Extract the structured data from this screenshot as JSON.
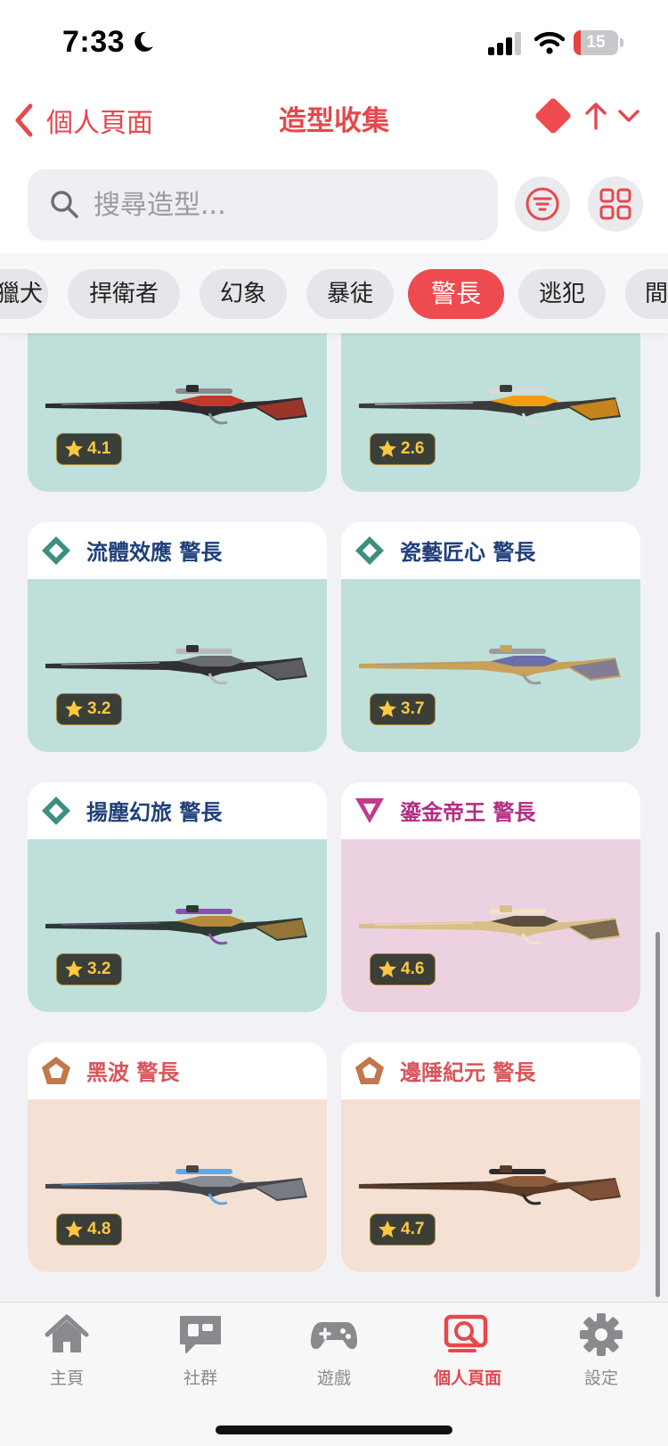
{
  "status_bar": {
    "time": "7:33",
    "battery_level": "15",
    "battery_fraction": 0.15
  },
  "nav": {
    "back_label": "個人頁面",
    "title": "造型收集"
  },
  "search": {
    "placeholder": "搜尋造型..."
  },
  "filter_chips": [
    "獵犬",
    "捍衛者",
    "幻象",
    "暴徒",
    "警長",
    "逃犯",
    "間諜"
  ],
  "active_chip": "警長",
  "skins": [
    {
      "name": "",
      "rating": "4.1",
      "tier": "select",
      "tier_color": "#3d8f80",
      "name_color": "#1f3f7a",
      "bg_color": "#bfe0da",
      "gun_colors": [
        "#2b2b30",
        "#c0392b",
        "#8a8a90"
      ]
    },
    {
      "name": "",
      "rating": "2.6",
      "tier": "select",
      "tier_color": "#3d8f80",
      "name_color": "#1f3f7a",
      "bg_color": "#bfe0da",
      "gun_colors": [
        "#3a3a3a",
        "#f39c12",
        "#d9d9d9"
      ]
    },
    {
      "name": "流體效應 警長",
      "rating": "3.2",
      "tier": "select",
      "tier_color": "#3d8f80",
      "name_color": "#1f3f7a",
      "bg_color": "#bfe0da",
      "gun_colors": [
        "#303036",
        "#6b6b72",
        "#b8b8be"
      ]
    },
    {
      "name": "瓷藝匠心 警長",
      "rating": "3.7",
      "tier": "select",
      "tier_color": "#3d8f80",
      "name_color": "#1f3f7a",
      "bg_color": "#bfe0da",
      "gun_colors": [
        "#c9a25a",
        "#6a6fa8",
        "#9a9aa0"
      ]
    },
    {
      "name": "揚塵幻旅 警長",
      "rating": "3.2",
      "tier": "select",
      "tier_color": "#3d8f80",
      "name_color": "#1f3f7a",
      "bg_color": "#bfe0da",
      "gun_colors": [
        "#2c3a33",
        "#b58a3c",
        "#8d4fb0"
      ]
    },
    {
      "name": "鎏金帝王 警長",
      "rating": "4.6",
      "tier": "exclusive",
      "tier_color": "#c23a8a",
      "name_color": "#b32d83",
      "bg_color": "#ecd2e1",
      "gun_colors": [
        "#d9c08a",
        "#5b4e3e",
        "#f0e4c4"
      ]
    },
    {
      "name": "黑波 警長",
      "rating": "4.8",
      "tier": "premium",
      "tier_color": "#c2784a",
      "name_color": "#d8555a",
      "bg_color": "#f5e1d4",
      "gun_colors": [
        "#45474c",
        "#8a8d94",
        "#5fa8e8"
      ]
    },
    {
      "name": "邊陲紀元 警長",
      "rating": "4.7",
      "tier": "premium",
      "tier_color": "#c2784a",
      "name_color": "#d8555a",
      "bg_color": "#f5e1d4",
      "gun_colors": [
        "#5a3b28",
        "#8c5a3c",
        "#2c2c2c"
      ]
    }
  ],
  "tab_bar": [
    {
      "label": "主頁",
      "icon": "home-icon",
      "active": false
    },
    {
      "label": "社群",
      "icon": "chat-icon",
      "active": false
    },
    {
      "label": "遊戲",
      "icon": "gamepad-icon",
      "active": false
    },
    {
      "label": "個人頁面",
      "icon": "profile-search-icon",
      "active": true
    },
    {
      "label": "設定",
      "icon": "gear-icon",
      "active": false
    }
  ],
  "colors": {
    "accent": "#e5484d",
    "inactive_tab": "#8a8a8e"
  }
}
